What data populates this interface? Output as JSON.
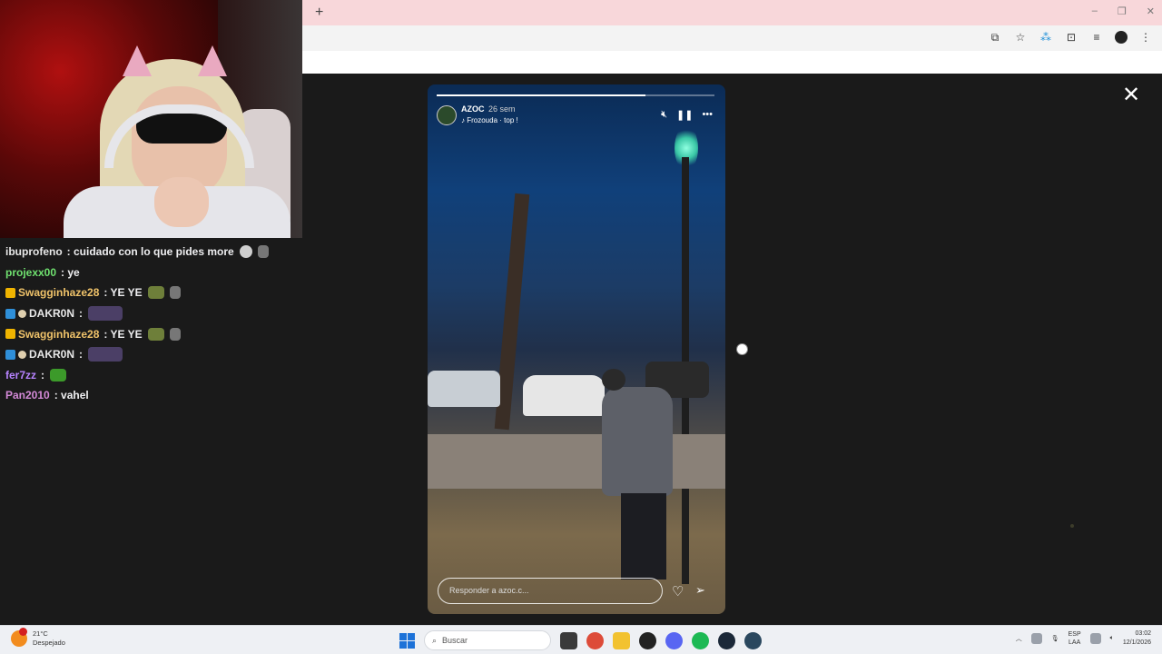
{
  "browser": {
    "new_tab_label": "+",
    "window_controls": [
      "–",
      "❐",
      "✕"
    ],
    "toolbar_icons": [
      "install-app-icon",
      "bookmark-star-icon",
      "extension-puzzle-icon",
      "media-control-icon",
      "profile-avatar-icon",
      "more-menu-icon"
    ]
  },
  "viewer": {
    "close_label": "✕"
  },
  "story": {
    "username": "AZOC",
    "time_ago": "26 sem",
    "music_label": "Frozouda · top !",
    "reply_placeholder": "Responder a azoc.c...",
    "progress": 0.75
  },
  "chat": {
    "messages": [
      {
        "user": "ibuprofeno",
        "color": "#e8e8e8",
        "text": ": cuidado con lo que pides more",
        "badges": [],
        "emotes": [
          "skull",
          "small"
        ]
      },
      {
        "user": "projexx00",
        "color": "#6fe06f",
        "text": ": ye",
        "badges": [],
        "emotes": []
      },
      {
        "user": "Swagginhaze28",
        "color": "#f0c36a",
        "text": ": YE YE",
        "badges": [
          "gold"
        ],
        "emotes": [
          "frog",
          "small"
        ]
      },
      {
        "user": "DAKR0N",
        "color": "#e8e8e8",
        "text": ":",
        "badges": [
          "blue",
          "dot"
        ],
        "emotes": [
          "wide"
        ]
      },
      {
        "user": "Swagginhaze28",
        "color": "#f0c36a",
        "text": ": YE YE",
        "badges": [
          "gold"
        ],
        "emotes": [
          "frog",
          "small"
        ]
      },
      {
        "user": "DAKR0N",
        "color": "#e8e8e8",
        "text": ":",
        "badges": [
          "blue",
          "dot"
        ],
        "emotes": [
          "wide"
        ]
      },
      {
        "user": "fer7zz",
        "color": "#b783ff",
        "text": ":",
        "badges": [],
        "emotes": [
          "green"
        ]
      },
      {
        "user": "Pan2010",
        "color": "#d48ad8",
        "text": ": vahel",
        "badges": [],
        "emotes": []
      }
    ]
  },
  "taskbar": {
    "weather_temp": "21°C",
    "weather_desc": "Despejado",
    "search_placeholder": "Buscar",
    "apps": [
      "file-explorer-icon",
      "chrome-icon",
      "folder-icon",
      "obs-icon",
      "discord-icon",
      "spotify-icon",
      "steam-icon",
      "steam-icon-2"
    ],
    "lang_line1": "ESP",
    "lang_line2": "LAA",
    "time": "03:02",
    "date": "12/1/2026"
  }
}
